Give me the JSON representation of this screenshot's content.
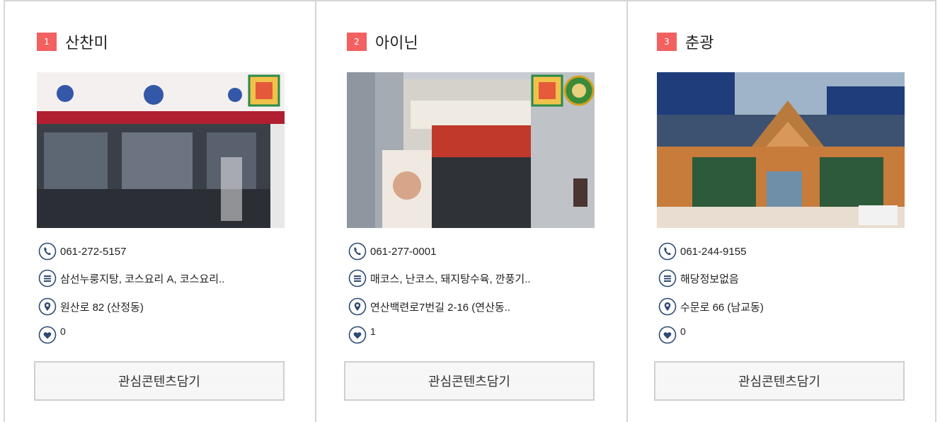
{
  "colors": {
    "badge": "#f26060",
    "border": "#d6d6d6",
    "icon_stroke": "#2d4a73"
  },
  "icons": {
    "phone": "phone-icon",
    "menu": "menu-list-icon",
    "location": "location-pin-icon",
    "like": "heart-icon"
  },
  "cards": [
    {
      "rank": "1",
      "name": "산찬미",
      "phone": "061-272-5157",
      "menu": "삼선누룽지탕, 코스요리 A, 코스요리..",
      "address": "원산로 82 (산정동)",
      "likes": "0",
      "button": "관심콘텐츠담기"
    },
    {
      "rank": "2",
      "name": "아이닌",
      "phone": "061-277-0001",
      "menu": "매코스, 난코스, 돼지탕수육, 깐풍기..",
      "address": "연산백련로7번길 2-16 (연산동..",
      "likes": "1",
      "button": "관심콘텐츠담기"
    },
    {
      "rank": "3",
      "name": "춘광",
      "phone": "061-244-9155",
      "menu": "해당정보없음",
      "address": "수문로 66 (남교동)",
      "likes": "0",
      "button": "관심콘텐츠담기"
    }
  ]
}
